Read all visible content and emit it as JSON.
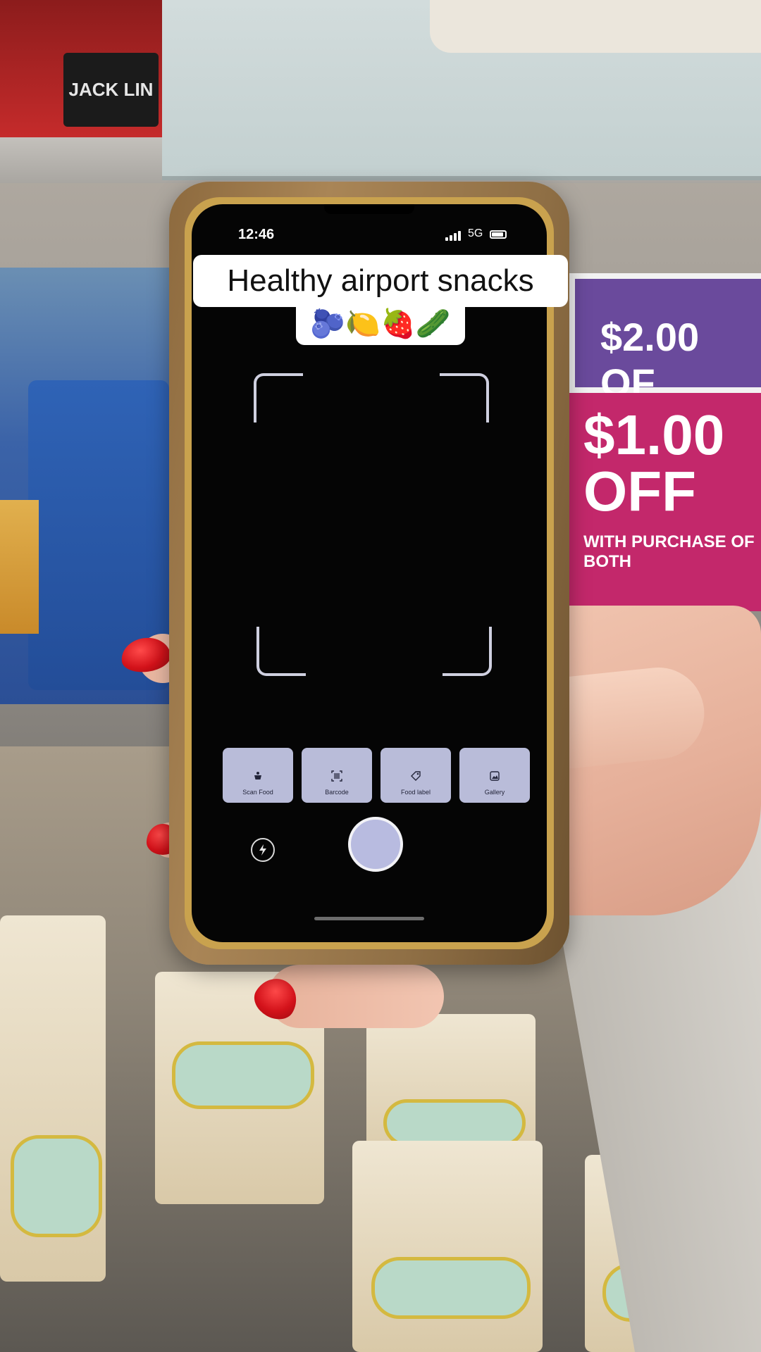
{
  "caption": {
    "line1": "Healthy airport snacks",
    "line2": "🫐🍋🍓🥒"
  },
  "status_bar": {
    "time": "12:46",
    "network": "5G"
  },
  "camera": {
    "modes": [
      {
        "label": "Scan Food",
        "icon": "scan-food-icon"
      },
      {
        "label": "Barcode",
        "icon": "barcode-icon"
      },
      {
        "label": "Food label",
        "icon": "food-label-icon"
      },
      {
        "label": "Gallery",
        "icon": "gallery-icon"
      }
    ],
    "accent_color": "#b9bcd9"
  },
  "background": {
    "promo_top": "$2.00 OF",
    "promo_bottom_big": "$1.00 OFF",
    "promo_bottom_small": "WITH PURCHASE OF BOTH",
    "jerky_brand": "JACK LIN"
  }
}
